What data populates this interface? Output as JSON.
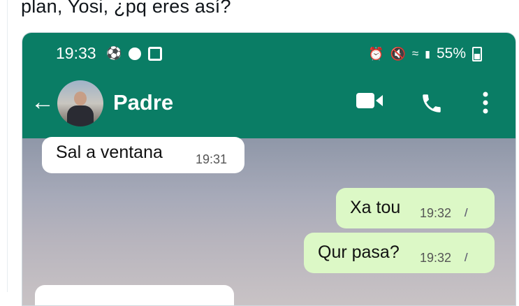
{
  "caption": "plan, Yosi, ¿pq eres así?",
  "status_bar": {
    "time": "19:33",
    "battery": "55%"
  },
  "header": {
    "contact_name": "Padre"
  },
  "messages": [
    {
      "text": "Sal a ventana",
      "time": "19:31"
    },
    {
      "text": "Xa tou",
      "time": "19:32"
    },
    {
      "text": "Qur pasa?",
      "time": "19:32"
    }
  ],
  "icons": [
    "back-arrow-icon",
    "video-call-icon",
    "phone-call-icon",
    "more-options-icon"
  ]
}
